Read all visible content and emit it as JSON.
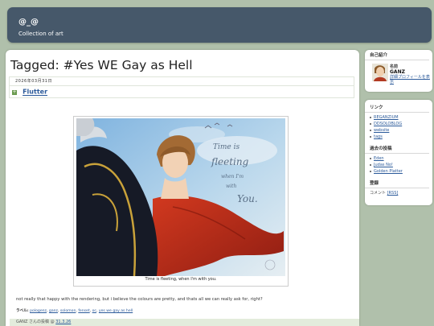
{
  "header": {
    "title": "@_@",
    "description": "Collection of art"
  },
  "main": {
    "heading": "Tagged: #Yes WE Gay as Hell",
    "post": {
      "date": "2026年03月31日",
      "title": "Flutter",
      "image_caption": "Time is fleeting, when I'm with you.",
      "image_handwritten_text": "Time is fleeting when I'm with you.",
      "body": "not really that happy with the rendering, but i believe the colours are pretty, and thats all we can really ask for, right?",
      "labels_title": "ラベル:",
      "labels": [
        "pologenz",
        "ganz",
        "solomon",
        "fenset",
        "oc",
        "yes we gay as hell"
      ],
      "footer_author": "GANZ さんの投稿",
      "footer_separator": "@",
      "footer_time": "31.3.26"
    }
  },
  "sidebar": {
    "profile": {
      "title": "自己紹介",
      "name_label": "名前",
      "name": "GANZ",
      "view_profile": "詳細プロフィールを表示"
    },
    "links": {
      "title": "リンク",
      "items": [
        "REGANZIUM",
        "DDSOLOBLOG",
        "website",
        "tags"
      ]
    },
    "archive": {
      "title": "過去の投稿",
      "items": [
        "Eden",
        "Judas No!",
        "Golden Platter"
      ]
    },
    "subscribe": {
      "title": "登録",
      "comment_label": "コメント",
      "rss_label": "[RSS]"
    }
  },
  "colors": {
    "background": "#b0c0ab",
    "header": "#46586a",
    "link": "#2b5a9a",
    "cape_red": "#c0301c"
  }
}
